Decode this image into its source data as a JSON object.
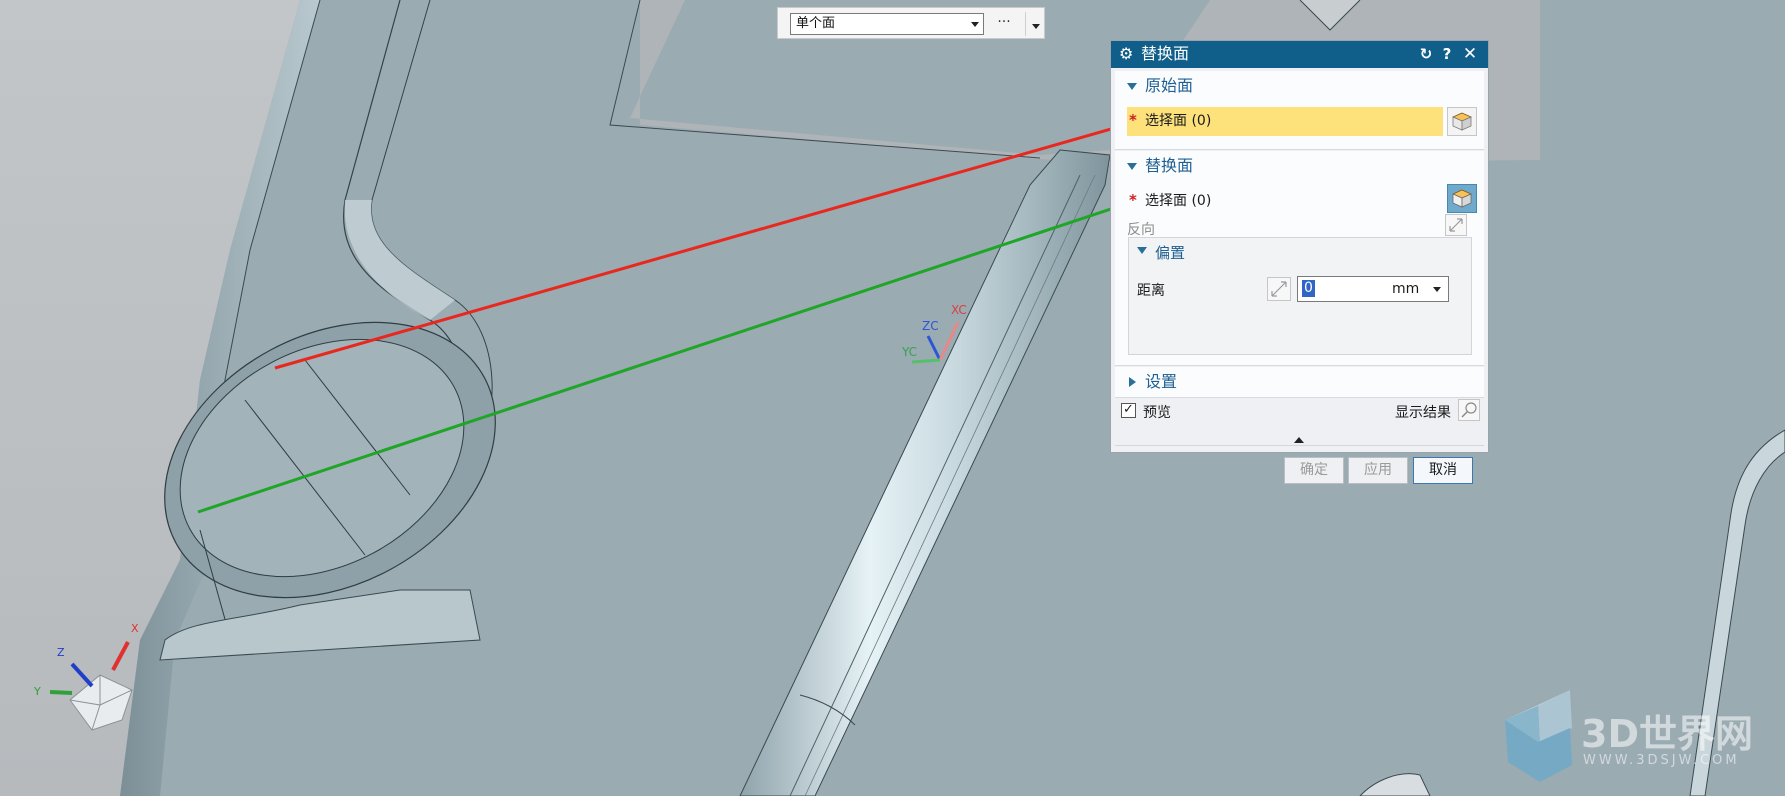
{
  "toolbar": {
    "filter_value": "单个面",
    "more_label": "···"
  },
  "dialog": {
    "title": "替换面",
    "colors": {
      "title_bar": "#0f5f8a",
      "active_selection": "#fde17a",
      "arrow_red": "#e8281e",
      "arrow_green": "#1fa527"
    },
    "original_face": {
      "title": "原始面",
      "select_label": "选择面 (0)"
    },
    "replacement_face": {
      "title": "替换面",
      "select_label": "选择面 (0)",
      "reverse_label": "反向",
      "offset": {
        "title": "偏置",
        "distance_label": "距离",
        "distance_value": "0",
        "unit": "mm"
      }
    },
    "settings": {
      "title": "设置"
    },
    "preview": {
      "label": "预览",
      "checked": true,
      "show_result_label": "显示结果"
    },
    "buttons": {
      "ok": "确定",
      "apply": "应用",
      "cancel": "取消"
    }
  },
  "viewport": {
    "wcs_labels": {
      "zc": "ZC",
      "xc": "XC",
      "yc": "YC"
    },
    "abs_triad_labels": {
      "z": "Z",
      "x": "X",
      "y": "Y"
    }
  },
  "watermark": {
    "text": "3D世界网",
    "sub": "WWW.3DSJW.COM"
  }
}
